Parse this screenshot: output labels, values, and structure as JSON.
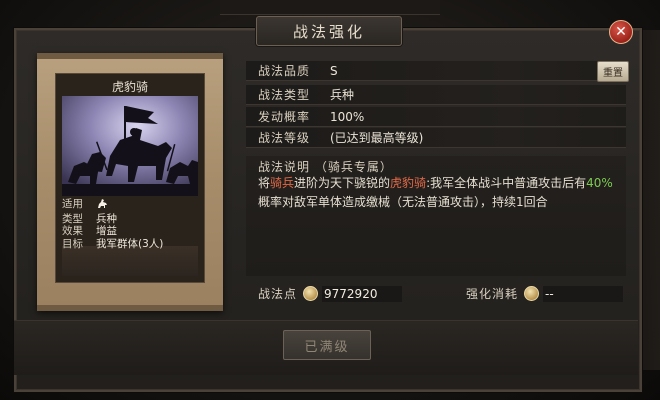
{
  "dialog": {
    "title": "战法强化",
    "close_glyph": "✕"
  },
  "card": {
    "name": "虎豹骑",
    "info": [
      {
        "key": "适用",
        "value": ""
      },
      {
        "key": "类型",
        "value": "兵种"
      },
      {
        "key": "效果",
        "value": "增益"
      },
      {
        "key": "目标",
        "value": "我军群体(3人)"
      }
    ],
    "applicable_icon": "cavalry-icon"
  },
  "attributes": {
    "quality_label": "战法品质",
    "quality_value": "S",
    "reset_label": "重置",
    "type_label": "战法类型",
    "type_value": "兵种",
    "rate_label": "发动概率",
    "rate_value": "100%",
    "level_label": "战法等级",
    "level_value": "(已达到最高等级)"
  },
  "description": {
    "title": "战法说明",
    "tag": "（骑兵专属）",
    "p1": "将",
    "p2": "骑兵",
    "p3": "进阶为天下骁锐的",
    "p4": "虎豹骑",
    "p5": ":我军全体战斗中普通攻击后有",
    "p6": "40%",
    "p7": "概率对敌军单体造成缴械（无法普通攻击），持续1回合"
  },
  "points": {
    "label": "战法点",
    "value": "9772920",
    "cost_label": "强化消耗",
    "cost_value": "--"
  },
  "button": {
    "enhance_label": "已满级"
  },
  "colors": {
    "highlight_red": "#e26a48",
    "highlight_green": "#7ccb52",
    "close_red": "#9c2219"
  }
}
